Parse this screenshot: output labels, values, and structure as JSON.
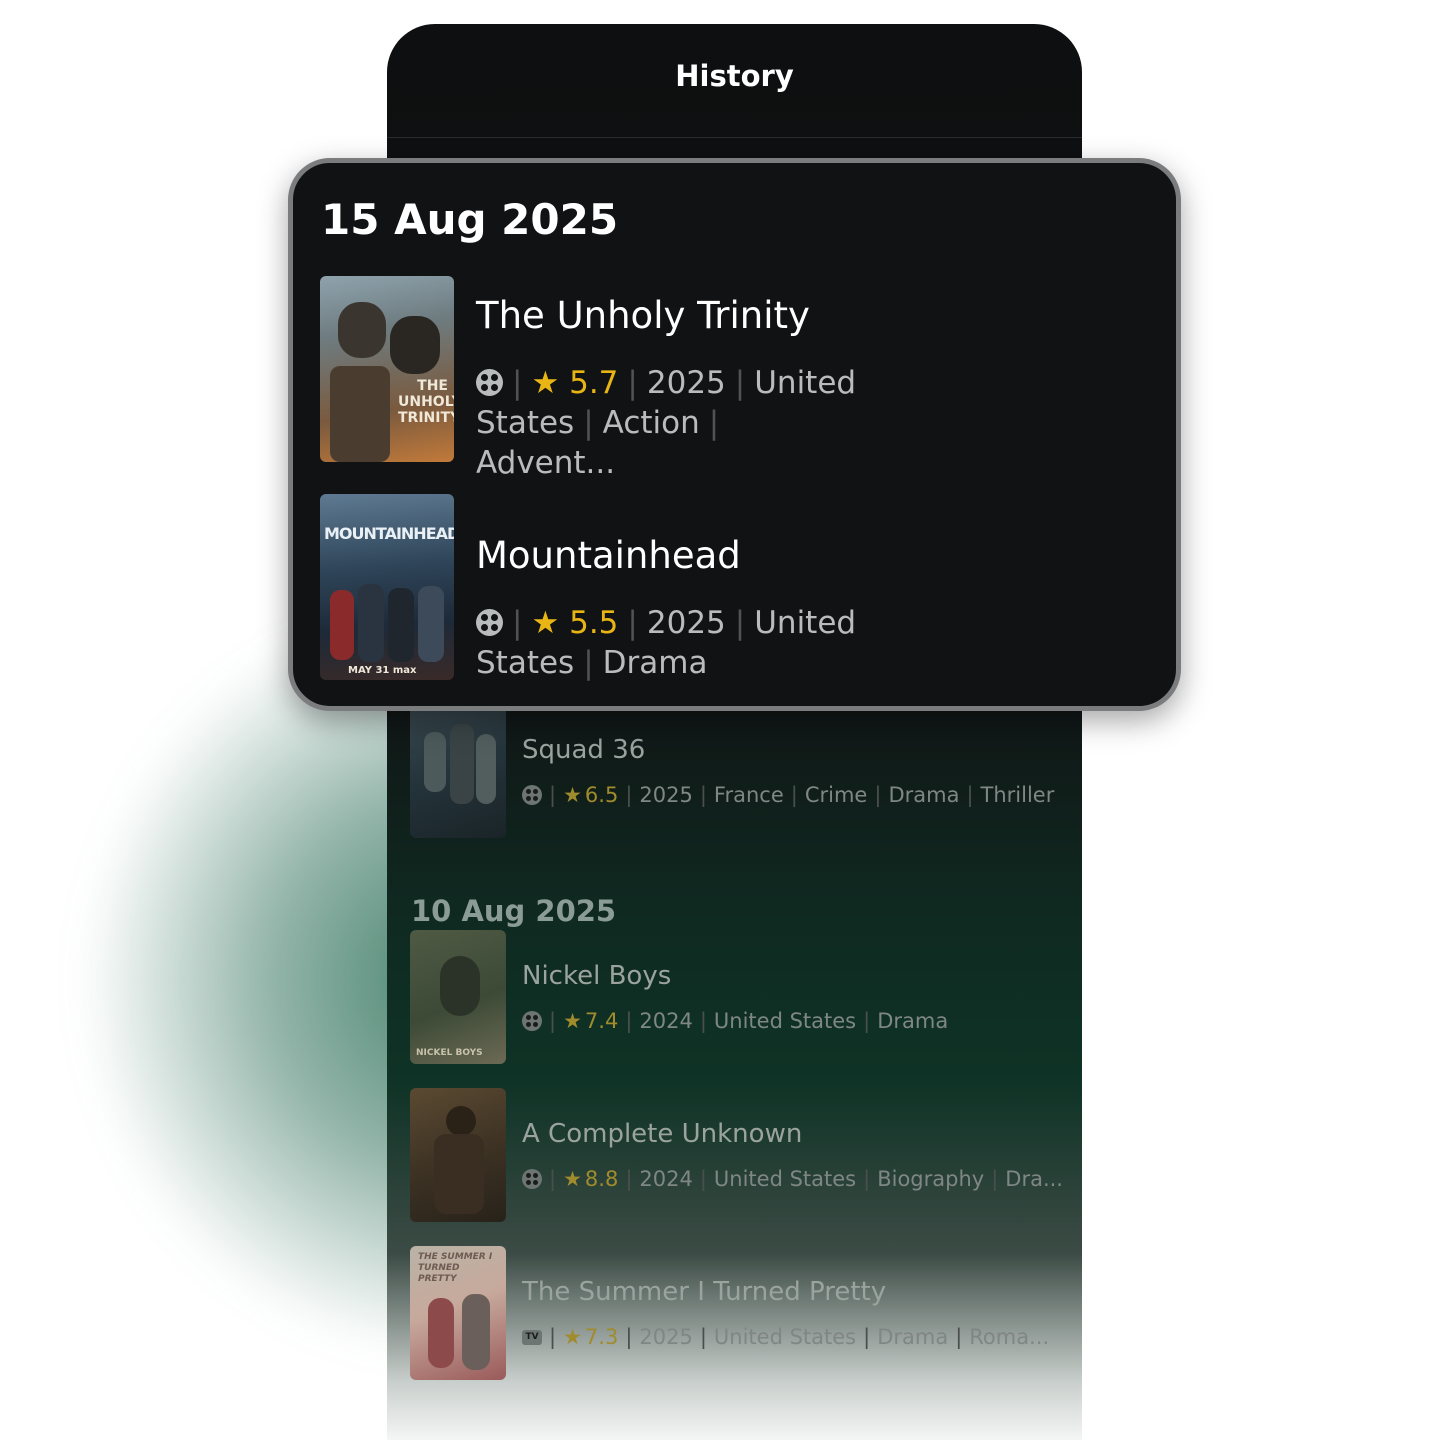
{
  "header": {
    "title": "History"
  },
  "featured": {
    "date": "15 Aug 2025",
    "items": [
      {
        "title": "The Unholy Trinity",
        "rating": "5.7",
        "meta_line1": [
          "2025",
          "United States",
          "Action"
        ],
        "meta_line2": "Advent...",
        "poster_text": "THE UNHOLY TRINITY",
        "type_icon": "film-reel-icon"
      },
      {
        "title": "Mountainhead",
        "rating": "5.5",
        "meta": [
          "2025",
          "United States",
          "Drama"
        ],
        "poster_text": "MOUNTAINHEAD",
        "poster_footer": "MAY 31 max",
        "type_icon": "film-reel-icon"
      }
    ]
  },
  "list": {
    "items_top": [
      {
        "title": "Squad 36",
        "rating": "6.5",
        "meta": [
          "2025",
          "France",
          "Crime",
          "Drama",
          "Thriller"
        ],
        "type_icon": "film-reel-icon"
      }
    ],
    "group2_date": "10 Aug 2025",
    "items_group2": [
      {
        "title": "Nickel Boys",
        "rating": "7.4",
        "meta": [
          "2024",
          "United States",
          "Drama"
        ],
        "poster_text": "NICKEL BOYS",
        "type_icon": "film-reel-icon"
      },
      {
        "title": "A Complete Unknown",
        "rating": "8.8",
        "meta": [
          "2024",
          "United States",
          "Biography",
          "Dra..."
        ],
        "type_icon": "film-reel-icon"
      },
      {
        "title": "The Summer I Turned Pretty",
        "rating": "7.3",
        "meta": [
          "2025",
          "United States",
          "Drama",
          "Roma..."
        ],
        "poster_text": "THE SUMMER I TURNED PRETTY",
        "type_icon": "tv-icon",
        "tv_label": "TV"
      }
    ]
  },
  "colors": {
    "accent_star": "#e9b514",
    "background": "#111214",
    "glow": "#2d6e55"
  }
}
